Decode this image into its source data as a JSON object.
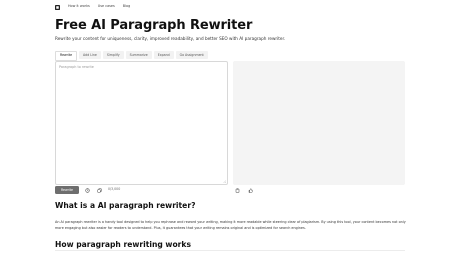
{
  "nav": {
    "links": [
      "How it works",
      "Use cases",
      "Blog"
    ]
  },
  "header": {
    "title": "Free AI Paragraph Rewriter",
    "subtitle": "Rewrite your content for uniqueness, clarity, improved readability, and better SEO with AI paragraph rewriter."
  },
  "tabs": [
    "Rewrite",
    "Add Line",
    "Simplify",
    "Summarize",
    "Expand",
    "Go Assignment"
  ],
  "editor": {
    "placeholder": "Paragraph to rewrite",
    "value": ""
  },
  "controls": {
    "rewrite_label": "Rewrite",
    "counter": "0/3,000"
  },
  "article": {
    "heading1": "What is a AI paragraph rewriter?",
    "paragraph1": "An AI paragraph rewriter is a handy tool designed to help you rephrase and reword your writing, making it more readable while steering clear of plagiarism. By using this tool, your content becomes not only more engaging but also easier for readers to understand. Plus, it guarantees that your writing remains original and is optimized for search engines.",
    "heading2": "How paragraph rewriting works"
  },
  "colors": {
    "button": "#6e6e6e",
    "output_bg": "#f4f4f4",
    "border": "#d8d8d8"
  },
  "icons": [
    "logo-icon",
    "history-icon",
    "copy-icon",
    "clipboard-icon",
    "thumbs-up-icon"
  ]
}
